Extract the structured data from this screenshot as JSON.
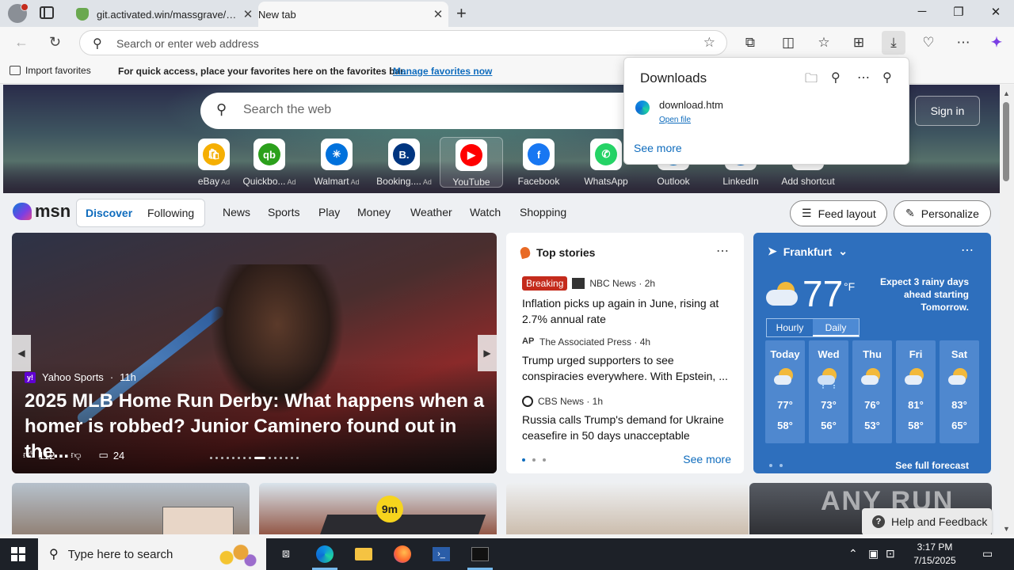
{
  "browser": {
    "tabs": [
      {
        "title": "git.activated.win/massgrave/Microsoft-Activation-Scripts",
        "active": false
      },
      {
        "title": "New tab",
        "active": true
      }
    ],
    "address": {
      "placeholder": "Search or enter web address"
    },
    "favorites_bar": {
      "import_label": "Import favorites",
      "message": "For quick access, place your favorites here on the favorites bar.",
      "manage_link": "Manage favorites now"
    }
  },
  "downloads": {
    "title": "Downloads",
    "item": {
      "file": "download.htm",
      "action": "Open file"
    },
    "see_more": "See more"
  },
  "newtab": {
    "search_placeholder": "Search the web",
    "sign_in": "Sign in",
    "tiles": [
      {
        "label": "eBay",
        "ad": "Ad",
        "icon": "ebay-icon",
        "color": "#f5af02"
      },
      {
        "label": "Quickbo...",
        "ad": "Ad",
        "icon": "quickbooks-icon",
        "color": "#2ca01c"
      },
      {
        "label": "Walmart",
        "ad": "Ad",
        "icon": "walmart-icon",
        "color": "#0071dc"
      },
      {
        "label": "Booking....",
        "ad": "Ad",
        "icon": "booking-icon",
        "color": "#003580"
      },
      {
        "label": "YouTube",
        "ad": "",
        "icon": "youtube-icon",
        "color": "#ff0000"
      },
      {
        "label": "Facebook",
        "ad": "",
        "icon": "facebook-icon",
        "color": "#1877f2"
      },
      {
        "label": "WhatsApp",
        "ad": "",
        "icon": "whatsapp-icon",
        "color": "#25d366"
      },
      {
        "label": "Outlook",
        "ad": "",
        "icon": "outlook-icon",
        "color": "#0078d4"
      },
      {
        "label": "LinkedIn",
        "ad": "",
        "icon": "linkedin-icon",
        "color": "#0a66c2"
      },
      {
        "label": "Add shortcut",
        "ad": "",
        "icon": "plus-icon",
        "color": "#ffffff"
      }
    ]
  },
  "msn": {
    "logo": "msn",
    "pill": {
      "discover": "Discover",
      "following": "Following"
    },
    "nav": [
      "News",
      "Sports",
      "Play",
      "Money",
      "Weather",
      "Watch",
      "Shopping"
    ],
    "feed_layout": "Feed layout",
    "personalize": "Personalize"
  },
  "hero_story": {
    "source": "Yahoo Sports",
    "age": "11h",
    "headline": "2025 MLB Home Run Derby: What happens when a homer is robbed? Junior Caminero found out in the...",
    "likes": "112",
    "comments": "24"
  },
  "top_stories": {
    "title": "Top stories",
    "items": [
      {
        "badge": "Breaking",
        "source": "NBC News · 2h",
        "title": "Inflation picks up again in June, rising at 2.7% annual rate"
      },
      {
        "badge": "",
        "source": "The Associated Press · 4h",
        "title": "Trump urged supporters to see conspiracies everywhere. With Epstein, ..."
      },
      {
        "badge": "",
        "source": "CBS News · 1h",
        "title": "Russia calls Trump's demand for Ukraine ceasefire in 50 days unacceptable"
      }
    ],
    "see_more": "See more"
  },
  "weather": {
    "location": "Frankfurt",
    "temp": "77",
    "unit": "°F",
    "note": "Expect 3 rainy days ahead starting Tomorrow.",
    "toggle": {
      "hourly": "Hourly",
      "daily": "Daily"
    },
    "days": [
      {
        "name": "Today",
        "hi": "77°",
        "lo": "58°",
        "icon": "partly-sunny-icon"
      },
      {
        "name": "Wed",
        "hi": "73°",
        "lo": "56°",
        "icon": "rain-showers-icon"
      },
      {
        "name": "Thu",
        "hi": "76°",
        "lo": "53°",
        "icon": "partly-sunny-icon"
      },
      {
        "name": "Fri",
        "hi": "81°",
        "lo": "58°",
        "icon": "partly-sunny-icon"
      },
      {
        "name": "Sat",
        "hi": "83°",
        "lo": "65°",
        "icon": "partly-sunny-icon"
      }
    ],
    "forecast_link": "See full forecast"
  },
  "strip_badge": "9m",
  "help": "Help and Feedback",
  "watermark": "ANY RUN",
  "taskbar": {
    "search_placeholder": "Type here to search",
    "time": "3:17 PM",
    "date": "7/15/2025"
  }
}
